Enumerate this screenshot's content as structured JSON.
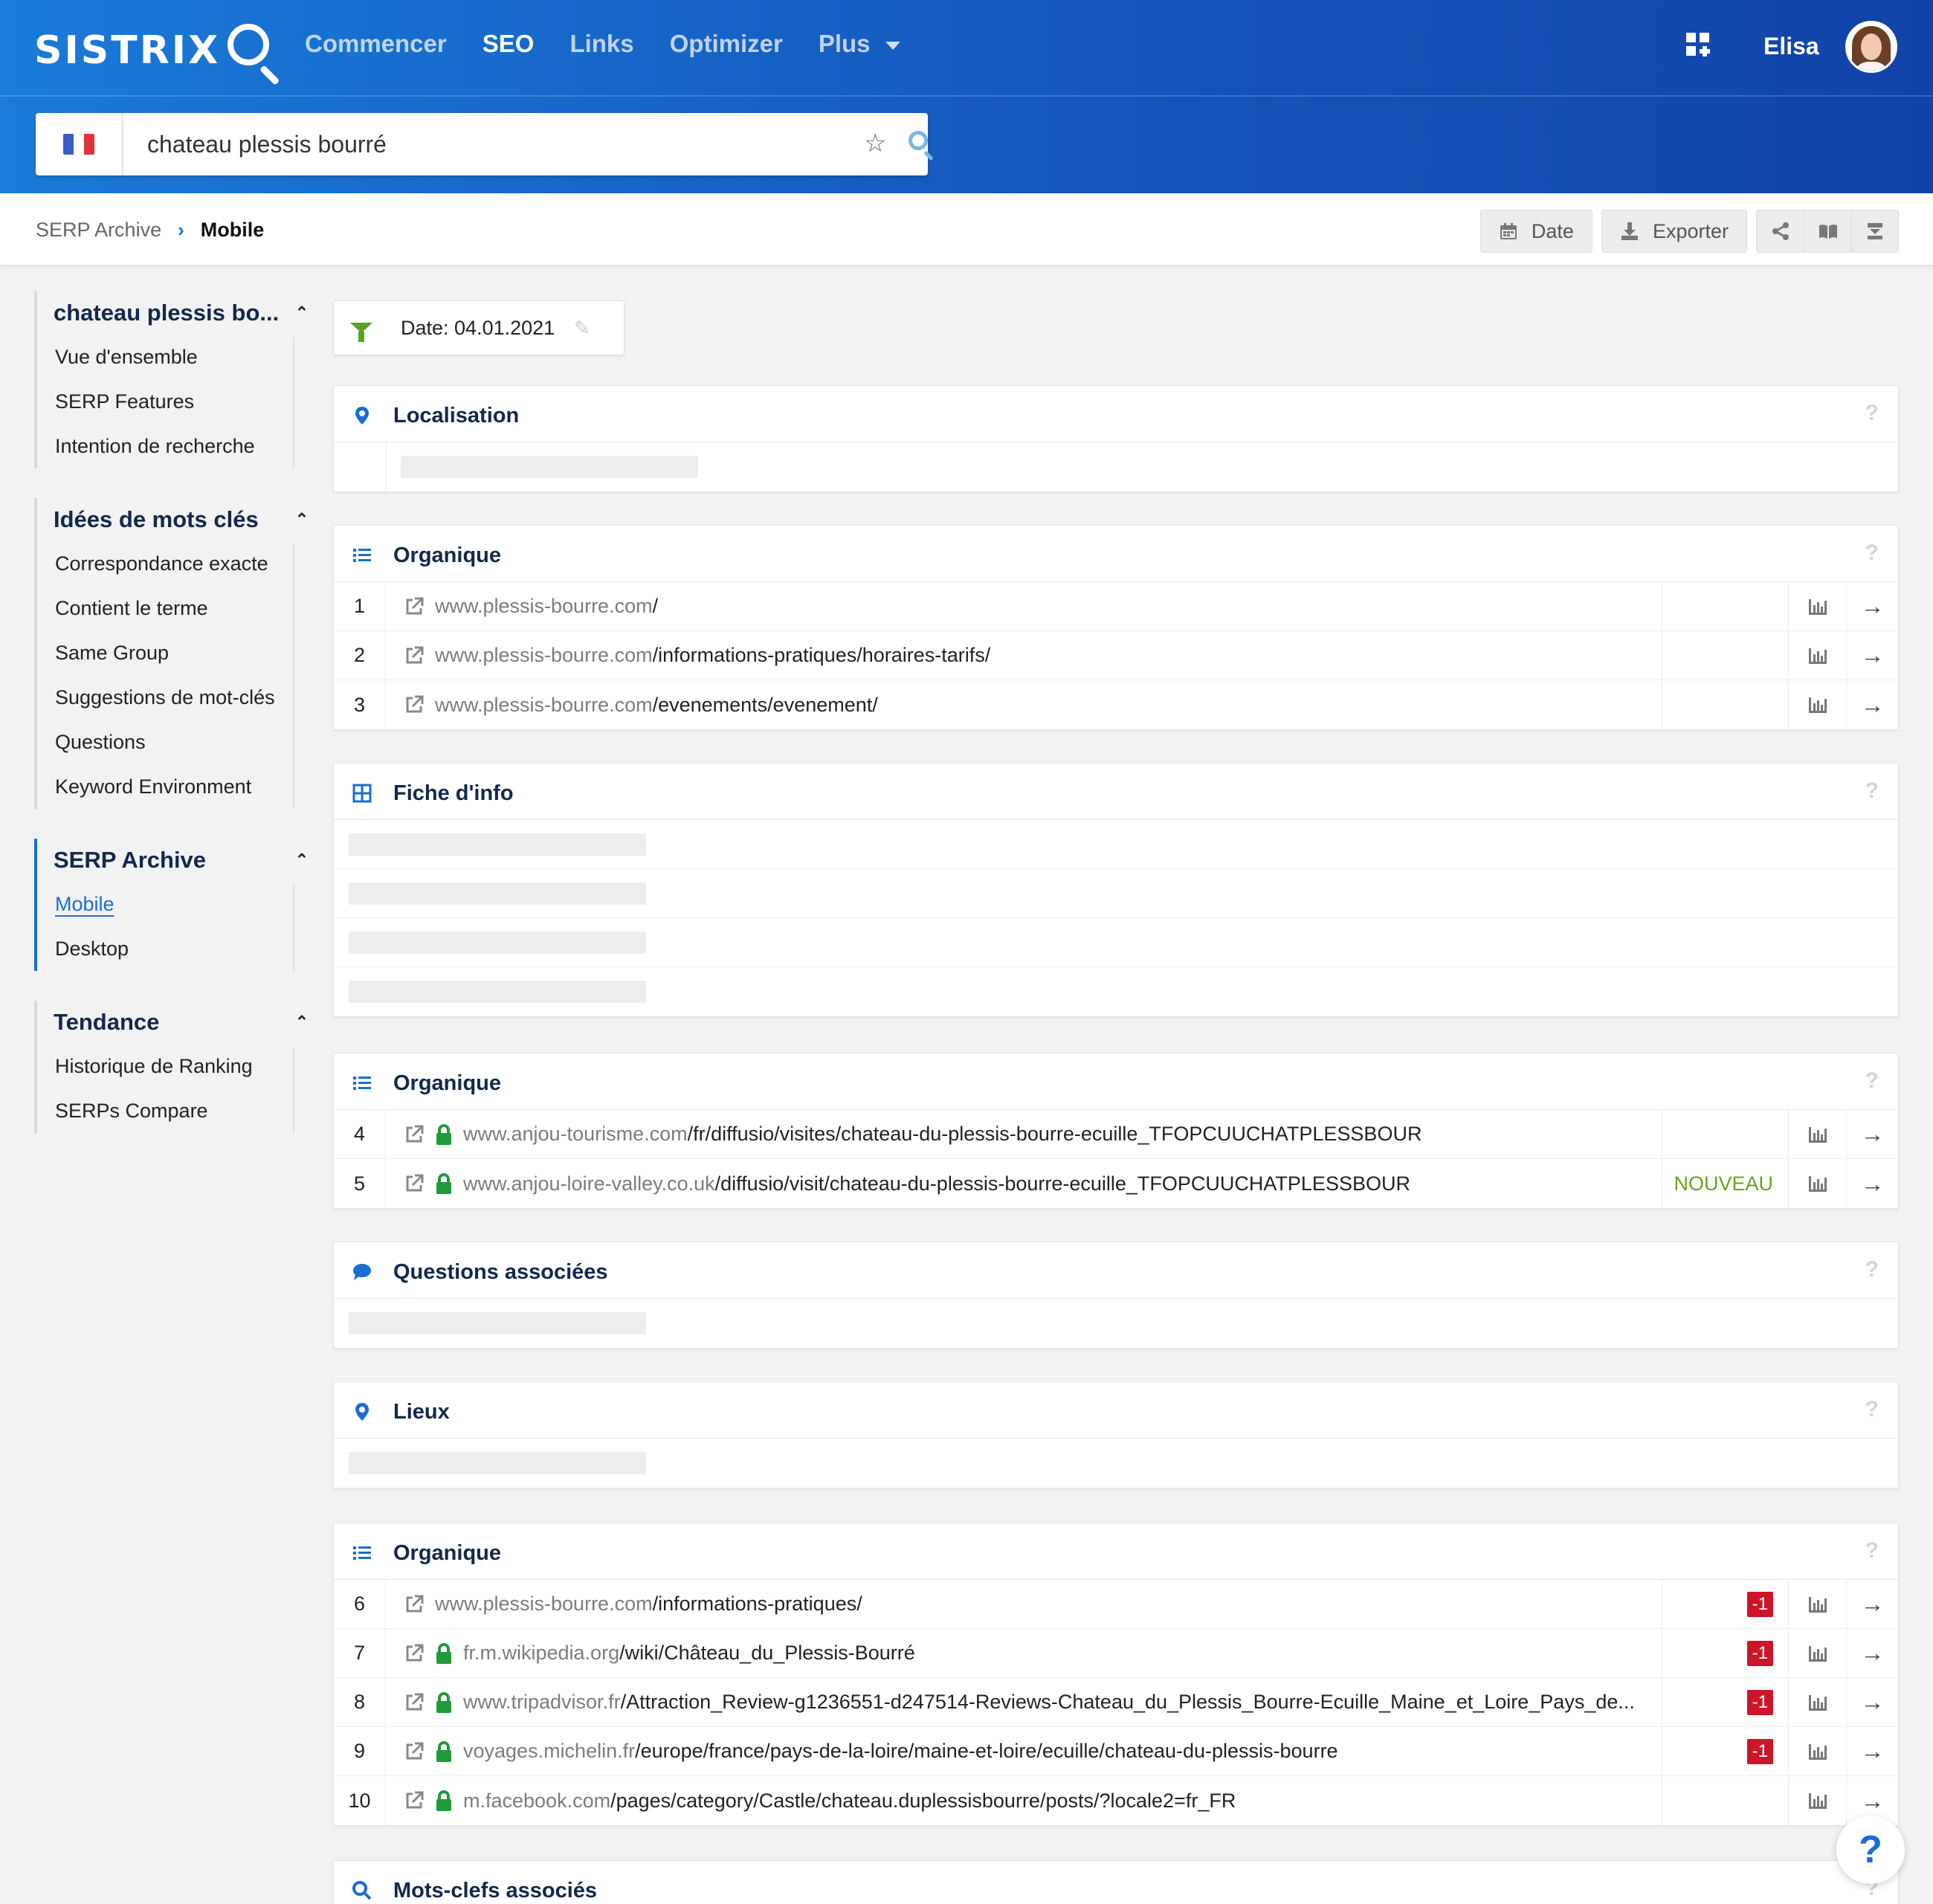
{
  "header": {
    "logo": "SISTRIX",
    "nav": [
      {
        "label": "Commencer",
        "active": false
      },
      {
        "label": "SEO",
        "active": true
      },
      {
        "label": "Links",
        "active": false
      },
      {
        "label": "Optimizer",
        "active": false
      },
      {
        "label": "Plus",
        "active": false
      }
    ],
    "user_name": "Elisa",
    "icons": {
      "apps": "apps-grid-icon",
      "avatar": "user-avatar"
    }
  },
  "search": {
    "value": "chateau plessis bourré",
    "country": "France",
    "flag_colors": [
      "#3b5cc9",
      "#ffffff",
      "#e1333e"
    ],
    "icons": [
      "star-icon",
      "search-icon"
    ]
  },
  "breadcrumb": {
    "parent": "SERP Archive",
    "current": "Mobile"
  },
  "toolbar": {
    "date_label": "Date",
    "export_label": "Exporter",
    "icons": [
      "calendar-icon",
      "download-icon",
      "share-icon",
      "book-icon",
      "save-icon"
    ]
  },
  "sidebar": {
    "groups": [
      {
        "title": "chateau plessis bo...",
        "items": [
          "Vue d'ensemble",
          "SERP Features",
          "Intention de recherche"
        ]
      },
      {
        "title": "Idées de mots clés",
        "items": [
          "Correspondance exacte",
          "Contient le terme",
          "Same Group",
          "Suggestions de mot-clés",
          "Questions",
          "Keyword Environment"
        ]
      },
      {
        "title": "SERP Archive",
        "items": [
          "Mobile",
          "Desktop"
        ],
        "current": "Mobile"
      },
      {
        "title": "Tendance",
        "items": [
          "Historique de Ranking",
          "SERPs Compare"
        ]
      }
    ]
  },
  "filter": {
    "label": "Date: 04.01.2021"
  },
  "panels": {
    "localisation": {
      "title": "Localisation",
      "help": "?"
    },
    "organic1": {
      "title": "Organique",
      "help": "?",
      "rows": [
        {
          "pos": "1",
          "domain": "www.plessis-bourre.com",
          "path": "/",
          "secure": false,
          "status": ""
        },
        {
          "pos": "2",
          "domain": "www.plessis-bourre.com",
          "path": "/informations-pratiques/horaires-tarifs/",
          "secure": false,
          "status": ""
        },
        {
          "pos": "3",
          "domain": "www.plessis-bourre.com",
          "path": "/evenements/evenement/",
          "secure": false,
          "status": ""
        }
      ]
    },
    "fiche": {
      "title": "Fiche d'info",
      "help": "?"
    },
    "organic2": {
      "title": "Organique",
      "help": "?",
      "rows": [
        {
          "pos": "4",
          "domain": "www.anjou-tourisme.com",
          "path": "/fr/diffusio/visites/chateau-du-plessis-bourre-ecuille_TFOPCUUCHATPLESSBOUR",
          "secure": true,
          "status": ""
        },
        {
          "pos": "5",
          "domain": "www.anjou-loire-valley.co.uk",
          "path": "/diffusio/visit/chateau-du-plessis-bourre-ecuille_TFOPCUUCHATPLESSBOUR",
          "secure": true,
          "status": "NOUVEAU"
        }
      ]
    },
    "questions": {
      "title": "Questions associées",
      "help": "?"
    },
    "lieux": {
      "title": "Lieux",
      "help": "?"
    },
    "organic3": {
      "title": "Organique",
      "help": "?",
      "rows": [
        {
          "pos": "6",
          "domain": "www.plessis-bourre.com",
          "path": "/informations-pratiques/",
          "secure": false,
          "status": "-1"
        },
        {
          "pos": "7",
          "domain": "fr.m.wikipedia.org",
          "path": "/wiki/Château_du_Plessis-Bourré",
          "secure": true,
          "status": "-1"
        },
        {
          "pos": "8",
          "domain": "www.tripadvisor.fr",
          "path": "/Attraction_Review-g1236551-d247514-Reviews-Chateau_du_Plessis_Bourre-Ecuille_Maine_et_Loire_Pays_de...",
          "secure": true,
          "status": "-1"
        },
        {
          "pos": "9",
          "domain": "voyages.michelin.fr",
          "path": "/europe/france/pays-de-la-loire/maine-et-loire/ecuille/chateau-du-plessis-bourre",
          "secure": true,
          "status": "-1"
        },
        {
          "pos": "10",
          "domain": "m.facebook.com",
          "path": "/pages/category/Castle/chateau.duplessisbourre/posts/?locale2=fr_FR",
          "secure": true,
          "status": ""
        }
      ]
    },
    "motsclefs": {
      "title": "Mots-clefs associés",
      "help": "?"
    }
  },
  "help_fab": "?",
  "colors": {
    "brand": "#1a6ed1",
    "title": "#13284b",
    "new": "#6aa31a",
    "negative": "#cc1628",
    "lock": "#1f9a3a"
  }
}
